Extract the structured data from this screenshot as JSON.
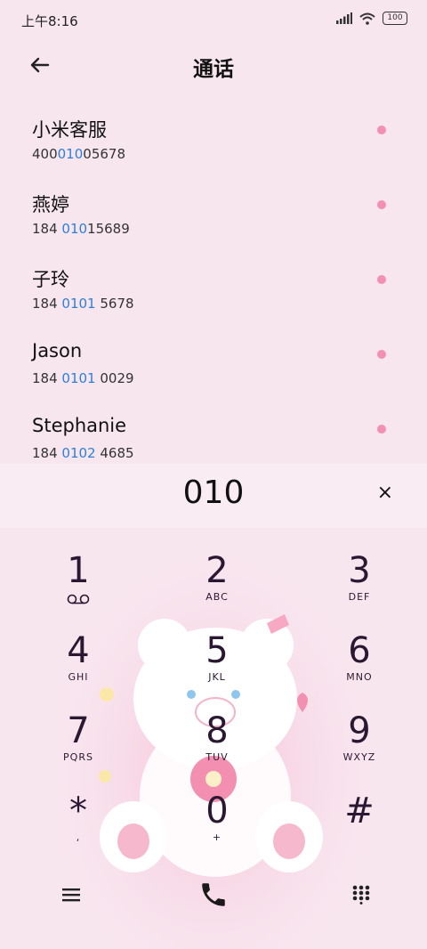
{
  "status": {
    "time": "上午8:16",
    "battery": "100"
  },
  "header": {
    "title": "通话"
  },
  "contacts": [
    {
      "name": "小米客服",
      "num_pre": "400",
      "num_hl": "010",
      "num_post": "05678"
    },
    {
      "name": "燕婷",
      "num_pre": "184 ",
      "num_hl": "010",
      "num_post": "15689"
    },
    {
      "name": "子玲",
      "num_pre": "184 ",
      "num_hl": "0101",
      "num_post": " 5678"
    },
    {
      "name": "Jason",
      "num_pre": "184 ",
      "num_hl": "0101",
      "num_post": " 0029"
    },
    {
      "name": "Stephanie",
      "num_pre": "184 ",
      "num_hl": "0102",
      "num_post": " 4685"
    }
  ],
  "dialer": {
    "input": "010",
    "clear": "×",
    "keys": [
      {
        "digit": "1",
        "letters": ""
      },
      {
        "digit": "2",
        "letters": "ABC"
      },
      {
        "digit": "3",
        "letters": "DEF"
      },
      {
        "digit": "4",
        "letters": "GHI"
      },
      {
        "digit": "5",
        "letters": "JKL"
      },
      {
        "digit": "6",
        "letters": "MNO"
      },
      {
        "digit": "7",
        "letters": "PQRS"
      },
      {
        "digit": "8",
        "letters": "TUV"
      },
      {
        "digit": "9",
        "letters": "WXYZ"
      },
      {
        "digit": "*",
        "letters": ","
      },
      {
        "digit": "0",
        "letters": "+"
      },
      {
        "digit": "#",
        "letters": ""
      }
    ]
  },
  "colors": {
    "highlight": "#2f7fd6",
    "accent": "#f38fb0",
    "background": "#f8e6ef"
  }
}
